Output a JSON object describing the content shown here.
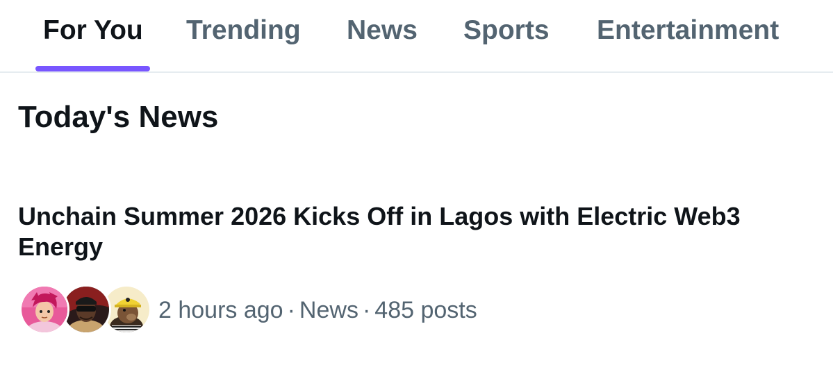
{
  "tabs": [
    {
      "label": "For You",
      "active": true
    },
    {
      "label": "Trending",
      "active": false
    },
    {
      "label": "News",
      "active": false
    },
    {
      "label": "Sports",
      "active": false
    },
    {
      "label": "Entertainment",
      "active": false
    }
  ],
  "section": {
    "title": "Today's News"
  },
  "story": {
    "headline": "Unchain Summer 2026 Kicks Off in Lagos with Electric Web3 Energy",
    "time": "2 hours ago",
    "category": "News",
    "posts": "485 posts",
    "separator": "·",
    "avatars": [
      {
        "icon": "user-avatar-pink-anime"
      },
      {
        "icon": "user-avatar-sunglasses"
      },
      {
        "icon": "user-avatar-bear-hardhat"
      }
    ]
  },
  "colors": {
    "accent": "#7856ff",
    "text_primary": "#0f1419",
    "text_secondary": "#536471",
    "divider": "#e6ecf0"
  }
}
